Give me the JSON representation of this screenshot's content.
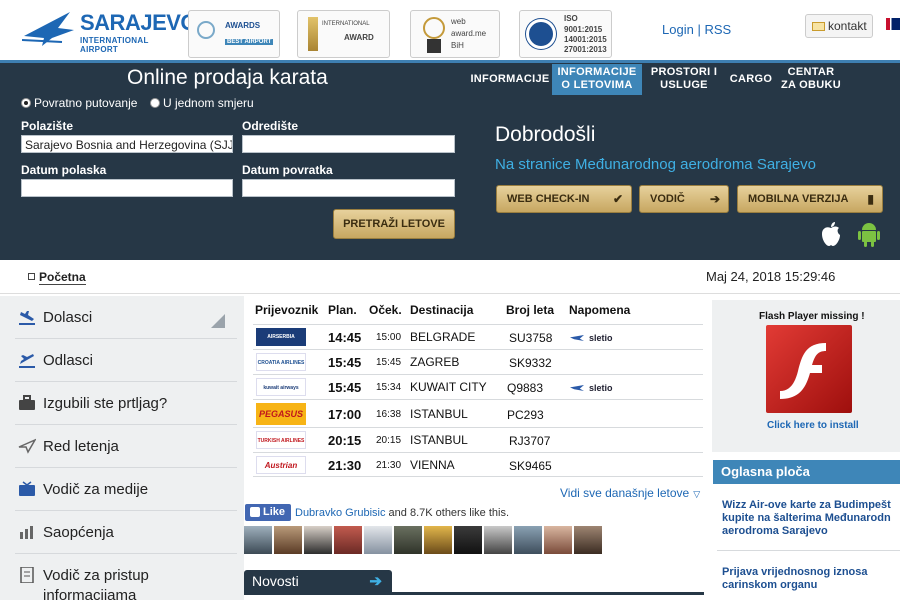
{
  "header": {
    "logo_name": "SARAJEVO",
    "logo_sub": "INTERNATIONAL AIRPORT",
    "awards": [
      {
        "line1": "AWARDS",
        "line2": "BEST AIRPORT"
      },
      {
        "line1": "INTERNATIONAL",
        "line2": "AWARD"
      },
      {
        "line1": "web",
        "line2": "award.me",
        "line3": "BiH"
      },
      {
        "line1": "ISO",
        "line2": "9001:2015",
        "line3": "14001:2015",
        "line4": "27001:2013"
      }
    ],
    "login": "Login",
    "rss": "RSS",
    "separator": "|",
    "contact": "kontakt"
  },
  "booking": {
    "title": "Online prodaja karata",
    "radio_return": "Povratno putovanje",
    "radio_oneway": "U jednom smjeru",
    "from_label": "Polazište",
    "from_value": "Sarajevo Bosnia and Herzegovina (SJJ)",
    "to_label": "Odredište",
    "to_value": "",
    "depart_label": "Datum polaska",
    "depart_value": "",
    "return_label": "Datum povratka",
    "return_value": "",
    "search_button": "PRETRAŽI LETOVE"
  },
  "nav": {
    "items": [
      {
        "line1": "INFORMACIJE",
        "line2": ""
      },
      {
        "line1": "INFORMACIJE",
        "line2": "O LETOVIMA"
      },
      {
        "line1": "PROSTORI I",
        "line2": "USLUGE"
      },
      {
        "line1": "CARGO",
        "line2": ""
      },
      {
        "line1": "CENTAR",
        "line2": "ZA OBUKU"
      }
    ],
    "active_index": 1
  },
  "welcome": {
    "title": "Dobrodošli",
    "subtitle": "Na stranice Međunarodnog aerodroma Sarajevo",
    "buttons": [
      {
        "label": "WEB CHECK-IN",
        "icon": "checkmark-icon"
      },
      {
        "label": "VODIČ",
        "icon": "arrow-right-icon"
      },
      {
        "label": "MOBILNA VERZIJA",
        "icon": "mobile-icon"
      }
    ]
  },
  "breadcrumb": {
    "label": "Početna"
  },
  "datetime": "Maj 24, 2018 15:29:46",
  "sidebar": {
    "items": [
      {
        "label": "Dolasci",
        "icon": "arrival-plane-icon"
      },
      {
        "label": "Odlasci",
        "icon": "departure-plane-icon"
      },
      {
        "label": "Izgubili ste prtljag?",
        "icon": "luggage-icon"
      },
      {
        "label": "Red letenja",
        "icon": "schedule-plane-icon"
      },
      {
        "label": "Vodič za medije",
        "icon": "tv-icon"
      },
      {
        "label": "Saopćenja",
        "icon": "chart-icon"
      },
      {
        "label": "Vodič za pristup",
        "label2": "informacijama",
        "icon": "document-icon"
      }
    ]
  },
  "flights": {
    "headers": [
      "Prijevoznik",
      "Plan.",
      "Oček.",
      "Destinacija",
      "Broj leta",
      "Napomena"
    ],
    "rows": [
      {
        "airline": "AIRSERBIA",
        "airline_color": "#1b3c78",
        "plan": "14:45",
        "expected": "15:00",
        "destination": "BELGRADE",
        "flight": "SU3758",
        "note": "sletio"
      },
      {
        "airline": "CROATIA AIRLINES",
        "airline_color": "#ffffff",
        "plan": "15:45",
        "expected": "15:45",
        "destination": "ZAGREB",
        "flight": "SK9332",
        "note": ""
      },
      {
        "airline": "kuwait airways",
        "airline_color": "#ffffff",
        "plan": "15:45",
        "expected": "15:34",
        "destination": "KUWAIT CITY",
        "flight": "Q9883",
        "note": "sletio"
      },
      {
        "airline": "PEGASUS",
        "airline_color": "#f7b416",
        "plan": "17:00",
        "expected": "16:38",
        "destination": "ISTANBUL",
        "flight": "PC293",
        "note": ""
      },
      {
        "airline": "TURKISH AIRLINES",
        "airline_color": "#ffffff",
        "plan": "20:15",
        "expected": "20:15",
        "destination": "ISTANBUL",
        "flight": "RJ3707",
        "note": ""
      },
      {
        "airline": "Austrian",
        "airline_color": "#ffffff",
        "plan": "21:30",
        "expected": "21:30",
        "destination": "VIENNA",
        "flight": "SK9465",
        "note": ""
      }
    ],
    "view_all": "Vidi sve današnje letove"
  },
  "social": {
    "like_label": "Like",
    "liker_name": "Dubravko Grubisic",
    "like_suffix": "and 8.7K others like this."
  },
  "news": {
    "tab_label": "Novosti"
  },
  "flash": {
    "title": "Flash Player missing !",
    "link": "Click here to install"
  },
  "board": {
    "title": "Oglasna ploča",
    "items": [
      {
        "line1": "Wizz Air-ove karte za Budimpešt",
        "line2": "kupite na šalterima Međunarodn",
        "line3": "aerodroma Sarajevo"
      },
      {
        "line1": "Prijava vrijednosnog iznosa",
        "line2": "carinskom organu",
        "line3": ""
      }
    ]
  },
  "colors": {
    "brand_blue": "#1d67b4",
    "dark_band": "#263746",
    "accent_blue": "#3e86b8",
    "light_blue_text": "#3fb0e4",
    "gold_button": "#c7a761"
  }
}
